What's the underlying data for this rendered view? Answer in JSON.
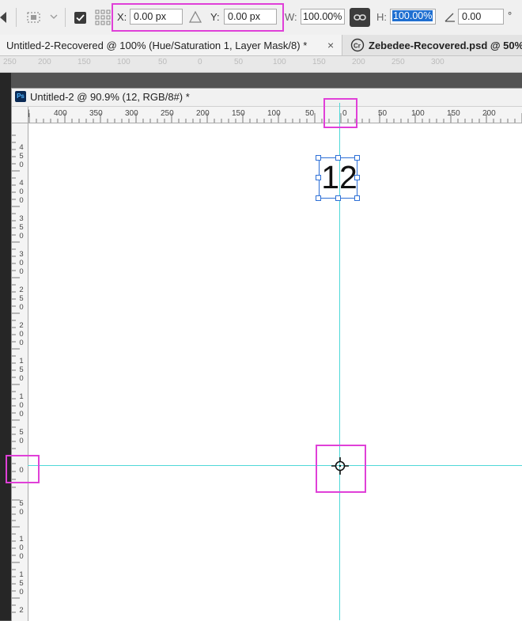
{
  "options_bar": {
    "x_label": "X:",
    "x_value": "0.00 px",
    "y_label": "Y:",
    "y_value": "0.00 px",
    "w_label": "W:",
    "w_value": "100.00%",
    "h_label": "H:",
    "h_value": "100.00%",
    "angle_value": "0.00",
    "degree_symbol": "°"
  },
  "tabs": [
    {
      "label": "Untitled-2-Recovered @ 100% (Hue/Saturation 1, Layer Mask/8) *",
      "close": "×"
    },
    {
      "label": "Zebedee-Recovered.psd @ 50%"
    }
  ],
  "back_ruler_labels": [
    "250",
    "200",
    "150",
    "100",
    "50",
    "0",
    "50",
    "100",
    "150",
    "200",
    "250",
    "300"
  ],
  "document": {
    "app_badge": "Ps",
    "title": "Untitled-2 @ 90.9% (12, RGB/8#) *",
    "text_layer": "12"
  },
  "ruler_top_labels": [
    "|",
    "400",
    "350",
    "300",
    "250",
    "200",
    "150",
    "100",
    "50",
    "0",
    "50",
    "100",
    "150",
    "200"
  ],
  "ruler_left_labels": [
    "4\n5\n0",
    "4\n0\n0",
    "3\n5\n0",
    "3\n0\n0",
    "2\n5\n0",
    "2\n0\n0",
    "1\n5\n0",
    "1\n0\n0",
    "5\n0",
    "0",
    "5\n0",
    "1\n0\n0",
    "1\n5\n0",
    "2"
  ],
  "colors": {
    "guide": "#4fd8d8",
    "highlight": "#e040d8",
    "selection": "#2d6fd6"
  }
}
